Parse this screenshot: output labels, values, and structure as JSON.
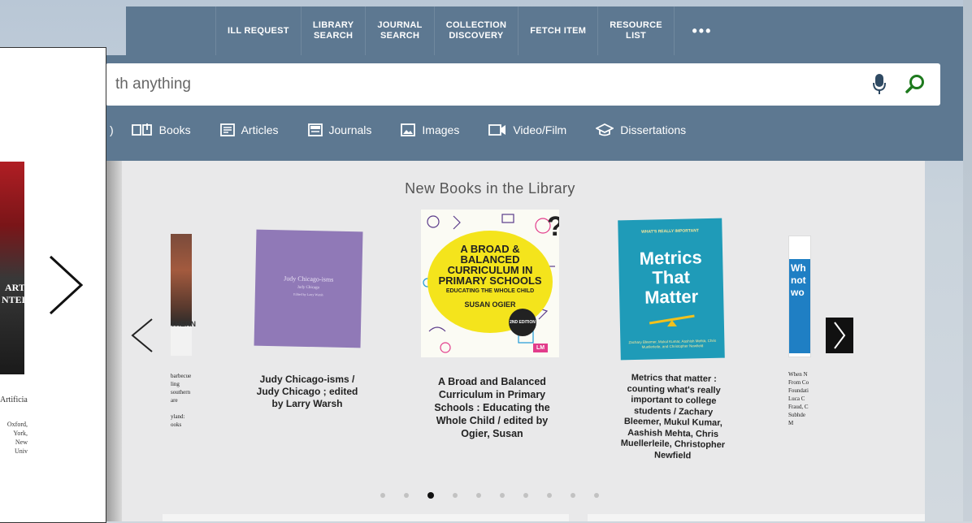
{
  "nav": {
    "items": [
      "ILL REQUEST",
      "LIBRARY\nSEARCH",
      "JOURNAL\nSEARCH",
      "COLLECTION\nDISCOVERY",
      "FETCH ITEM",
      "RESOURCE\nLIST"
    ],
    "more": "•••"
  },
  "search": {
    "placeholder": "th anything"
  },
  "filters": [
    "Books",
    "Articles",
    "Journals",
    "Images",
    "Video/Film",
    "Dissertations"
  ],
  "new_books": {
    "title": "New Books in the Library",
    "books": [
      {
        "caption": "Judy Chicago-isms / Judy Chicago ; edited by Larry Warsh",
        "cover_title": "Judy Chicago-isms",
        "cover_author": "Judy Chicago",
        "cover_editor": "Edited by Larry Warsh"
      },
      {
        "caption": "A Broad and Balanced Curriculum in Primary Schools : Educating the Whole Child / edited by Ogier, Susan",
        "cover_title": "A BROAD & BALANCED CURRICULUM IN PRIMARY SCHOOLS",
        "cover_subtitle": "EDUCATING THE WHOLE CHILD",
        "cover_author": "SUSAN OGIER",
        "cover_badge": "2ND EDITION",
        "cover_logo": "LM"
      },
      {
        "caption": "Metrics that matter : counting what's really important to college students / Zachary Bleemer, Mukul Kumar, Aashish Mehta, Chris Muellerleile, Christopher Newfield",
        "cover_title": "Metrics That Matter",
        "cover_top": "WHAT'S REALLY IMPORTANT",
        "cover_authors": "Zachary Bleemer, Mukul Kumar, Aashish Mehta, Chris Muellerleile, and Christopher Newfield"
      }
    ],
    "left_partial_caption": "barbecue\nling\nsouthern\nare\n\nyland:\nooks",
    "right_partial_caption": "When N\nFrom Co\nFoundati\nLuca C\nFraud, C\nSubhde\nM",
    "right_partial_cover": "Wh\nnot\nwo",
    "left_partial_cover": "THERN",
    "active_dot": 2,
    "dot_count": 10
  },
  "overlay": {
    "cover_text_1": "ART",
    "cover_text_2": "NTEL",
    "caption_1": "Artificia",
    "caption_2": "Oxford, \nYork, New\nUniv"
  },
  "colors": {
    "header": "#5d7891",
    "accent_green": "#1e7a1e",
    "mic": "#2f4a63"
  }
}
